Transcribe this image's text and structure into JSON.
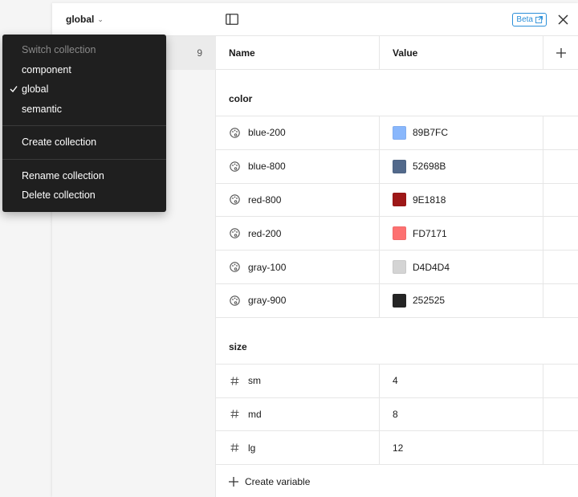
{
  "collection": {
    "name": "global",
    "mode_count": "9"
  },
  "toolbar": {
    "beta_label": "Beta"
  },
  "table": {
    "col_name": "Name",
    "col_value": "Value"
  },
  "groups": [
    {
      "name": "color",
      "variables": [
        {
          "name": "blue-200",
          "value": "89B7FC",
          "swatch": "#89B7FC"
        },
        {
          "name": "blue-800",
          "value": "52698B",
          "swatch": "#52698B"
        },
        {
          "name": "red-800",
          "value": "9E1818",
          "swatch": "#9E1818"
        },
        {
          "name": "red-200",
          "value": "FD7171",
          "swatch": "#FD7171"
        },
        {
          "name": "gray-100",
          "value": "D4D4D4",
          "swatch": "#D4D4D4"
        },
        {
          "name": "gray-900",
          "value": "252525",
          "swatch": "#252525"
        }
      ]
    },
    {
      "name": "size",
      "variables": [
        {
          "name": "sm",
          "value": "4"
        },
        {
          "name": "md",
          "value": "8"
        },
        {
          "name": "lg",
          "value": "12"
        }
      ]
    }
  ],
  "create_variable_label": "Create variable",
  "dropdown": {
    "header": "Switch collection",
    "collections": [
      "component",
      "global",
      "semantic"
    ],
    "selected": "global",
    "create_label": "Create collection",
    "rename_label": "Rename collection",
    "delete_label": "Delete collection"
  }
}
